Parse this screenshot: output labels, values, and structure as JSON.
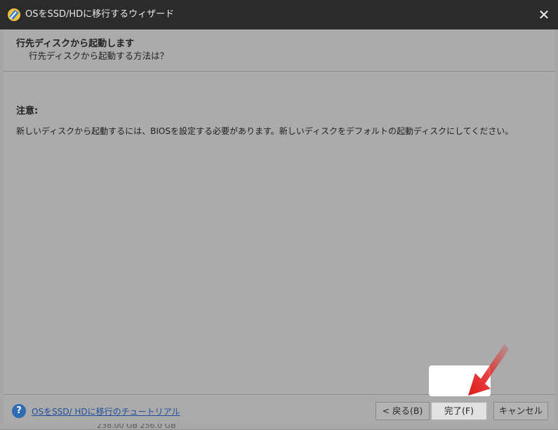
{
  "window": {
    "title": "OSをSSD/HDに移行するウィザード",
    "close_glyph": "✕"
  },
  "header": {
    "title": "行先ディスクから起動します",
    "subtitle": "行先ディスクから起動する方法は？"
  },
  "content": {
    "note_label": "注意:",
    "note_text": "新しいディスクから起動するには、BIOSを設定する必要があります。新しいディスクをデフォルトの起動ディスクにしてください。"
  },
  "footer": {
    "help_glyph": "?",
    "help_link": "OSをSSD/ HDに移行のチュートリアル",
    "back_button": "< 戻る(B)",
    "finish_button": "完了(F)",
    "cancel_button": "キャンセル"
  },
  "background_fragment": "238.00 GB   256.0 GB",
  "colors": {
    "titlebar": "#2b2b2b",
    "dialog_body_dimmed": "#ababab",
    "link": "#1f4f9a",
    "help_icon": "#2d6cb3",
    "highlight": "#ffffff",
    "arrow": "#e32222"
  },
  "icons": {
    "app": "minitool-partition-wizard-icon",
    "close": "close-icon",
    "help": "help-circle-icon",
    "pointer": "red-arrow-icon"
  }
}
